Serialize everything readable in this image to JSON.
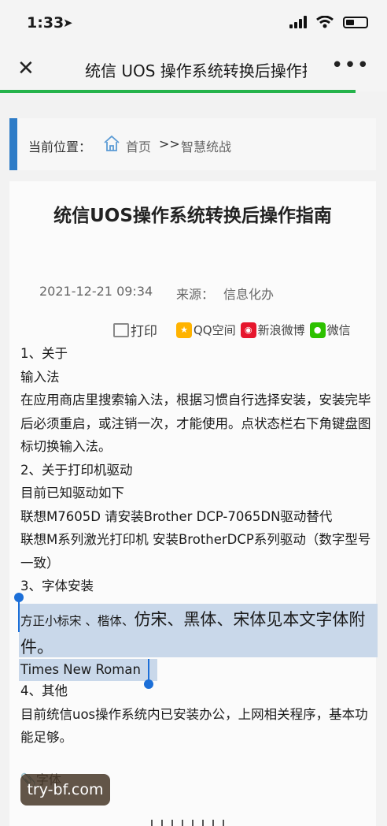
{
  "status_bar": {
    "time": "1:33"
  },
  "nav": {
    "close": "✕",
    "title": "统信 UOS 操作系统转换后操作指南",
    "more": "•••"
  },
  "breadcrumb": {
    "label": "当前位置：",
    "home": "首页",
    "sep": ">>",
    "current": "智慧统战"
  },
  "article": {
    "title": "统信UOS操作系统转换后操作指南",
    "date": "2021-12-21 09:34",
    "source_label": "来源：",
    "source": "信息化办",
    "print": "打印",
    "share": {
      "qq": "QQ空间",
      "weibo": "新浪微博",
      "wechat": "微信"
    },
    "lines": [
      "1、关于",
      "输入法",
      "在应用商店里搜索输入法，根据习惯自行选择安装，安装完毕后必须重启，或注销一次，才能使用。点状态栏右下角键盘图标切换输入法。",
      "2、关于打印机驱动",
      "目前已知驱动如下",
      "联想M7605D  请安装Brother DCP-7065DN驱动替代",
      "联想M系列激光打印机  安装BrotherDCP系列驱动（数字型号一致）",
      "3、字体安装"
    ],
    "selected_small": "方正小标宋 、楷体、",
    "selected_large": "仿宋、黑体、宋体见本文字体附件。",
    "selected_line3": "Times New Roman",
    "after_lines": [
      "4、其他",
      "目前统信uos操作系统内已安装办公，上网相关程序，基本功能足够。"
    ],
    "attachment": "字体"
  },
  "watermark": "try-bf.com"
}
